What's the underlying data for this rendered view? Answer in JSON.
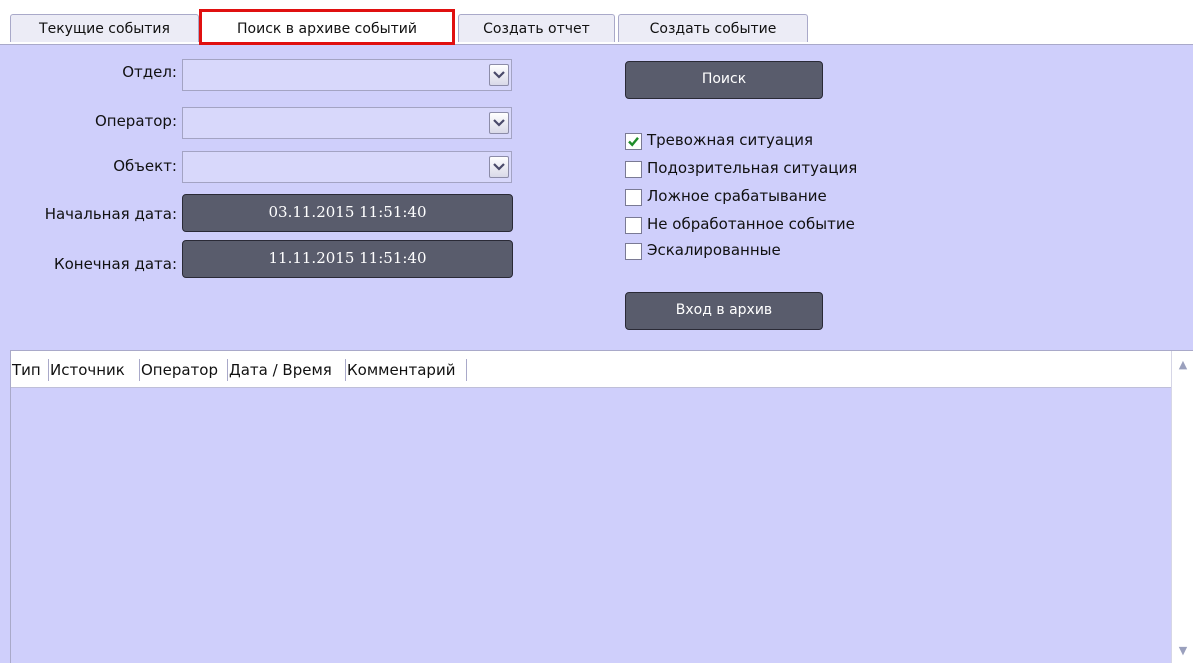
{
  "tabs": [
    {
      "label": "Текущие события",
      "active": false
    },
    {
      "label": "Поиск в архиве событий",
      "active": true
    },
    {
      "label": "Создать отчет",
      "active": false
    },
    {
      "label": "Создать событие",
      "active": false
    }
  ],
  "filters": {
    "department_label": "Отдел:",
    "department_value": "",
    "operator_label": "Оператор:",
    "operator_value": "",
    "object_label": "Объект:",
    "object_value": "",
    "start_date_label": "Начальная дата:",
    "start_date_value": "03.11.2015 11:51:40",
    "end_date_label": "Конечная дата:",
    "end_date_value": "11.11.2015 11:51:40"
  },
  "search_button_label": "Поиск",
  "checkboxes": [
    {
      "label": "Тревожная ситуация",
      "checked": true
    },
    {
      "label": "Подозрительная ситуация",
      "checked": false
    },
    {
      "label": "Ложное срабатывание",
      "checked": false
    },
    {
      "label": "Не обработанное событие",
      "checked": false
    },
    {
      "label": "Эскалированные",
      "checked": false
    }
  ],
  "archive_button_label": "Вход в архив",
  "table": {
    "columns": [
      "Тип",
      "Источник",
      "Оператор",
      "Дата / Время",
      "Комментарий"
    ],
    "rows": []
  },
  "icons": {
    "combo_arrow": "chevron-down-icon",
    "check_mark": "check-icon",
    "scroll_up": "arrow-up-icon",
    "scroll_down": "arrow-down-icon"
  },
  "colors": {
    "panel_background": "#cfcffb",
    "active_tab_border": "#e01010",
    "dark_button": "#595c6c",
    "check_mark": "#1e8c2a"
  }
}
